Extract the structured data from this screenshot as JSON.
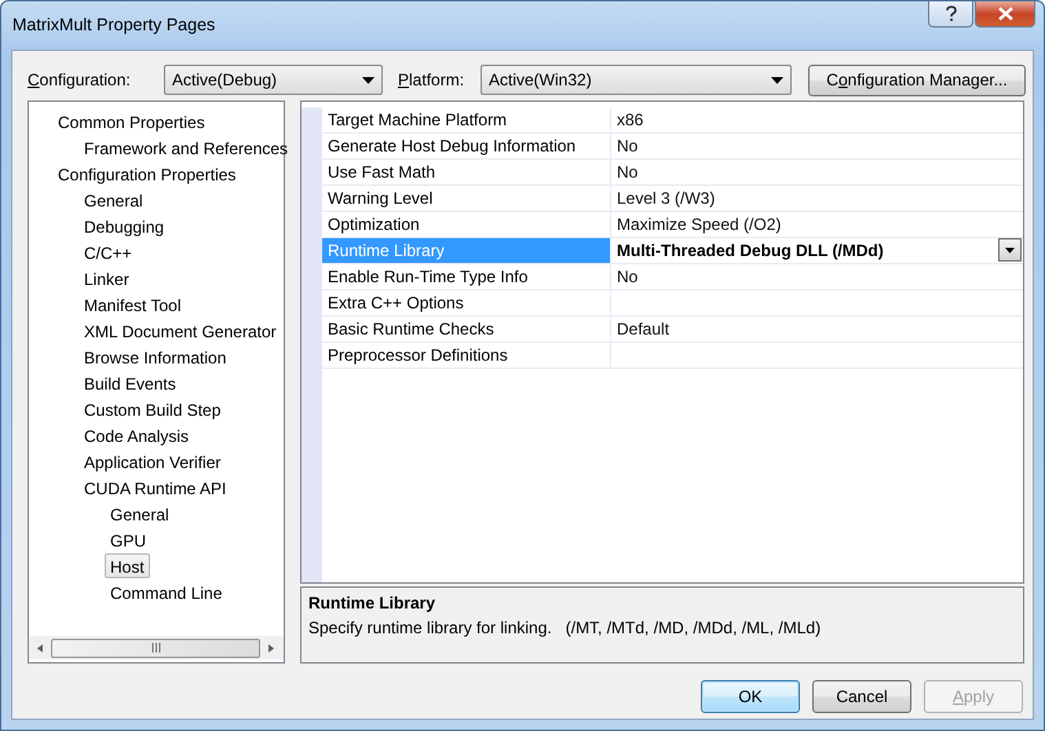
{
  "window": {
    "title": "MatrixMult Property Pages"
  },
  "toolbar": {
    "configuration": {
      "label": [
        {
          "text": "C",
          "underline": true
        },
        {
          "text": "onfiguration:",
          "underline": false
        }
      ],
      "value": "Active(Debug)"
    },
    "platform": {
      "label": [
        {
          "text": "P",
          "underline": true
        },
        {
          "text": "latform:",
          "underline": false
        }
      ],
      "value": "Active(Win32)"
    },
    "manager_button": {
      "label": [
        {
          "text": "C",
          "underline": false
        },
        {
          "text": "o",
          "underline": true
        },
        {
          "text": "nfiguration Manager...",
          "underline": false
        }
      ]
    }
  },
  "tree": [
    {
      "label": "Common Properties",
      "selected": false,
      "children": [
        {
          "label": "Framework and References",
          "selected": false
        }
      ]
    },
    {
      "label": "Configuration Properties",
      "selected": false,
      "children": [
        {
          "label": "General",
          "selected": false
        },
        {
          "label": "Debugging",
          "selected": false
        },
        {
          "label": "C/C++",
          "selected": false
        },
        {
          "label": "Linker",
          "selected": false
        },
        {
          "label": "Manifest Tool",
          "selected": false
        },
        {
          "label": "XML Document Generator",
          "selected": false
        },
        {
          "label": "Browse Information",
          "selected": false
        },
        {
          "label": "Build Events",
          "selected": false
        },
        {
          "label": "Custom Build Step",
          "selected": false
        },
        {
          "label": "Code Analysis",
          "selected": false
        },
        {
          "label": "Application Verifier",
          "selected": false
        },
        {
          "label": "CUDA Runtime API",
          "selected": false,
          "children": [
            {
              "label": "General",
              "selected": false
            },
            {
              "label": "GPU",
              "selected": false
            },
            {
              "label": "Host",
              "selected": true
            },
            {
              "label": "Command Line",
              "selected": false
            }
          ]
        }
      ]
    }
  ],
  "properties": [
    {
      "name": "Target Machine Platform",
      "value": "x86",
      "selected": false,
      "modified": false
    },
    {
      "name": "Generate Host Debug Information",
      "value": "No",
      "selected": false,
      "modified": false
    },
    {
      "name": "Use Fast Math",
      "value": "No",
      "selected": false,
      "modified": false
    },
    {
      "name": "Warning Level",
      "value": "Level 3 (/W3)",
      "selected": false,
      "modified": false
    },
    {
      "name": "Optimization",
      "value": "Maximize Speed (/O2)",
      "selected": false,
      "modified": false
    },
    {
      "name": "Runtime Library",
      "value": "Multi-Threaded Debug DLL (/MDd)",
      "selected": true,
      "modified": true
    },
    {
      "name": "Enable Run-Time Type Info",
      "value": "No",
      "selected": false,
      "modified": false
    },
    {
      "name": "Extra C++ Options",
      "selected": false
    },
    {
      "name": "Basic Runtime Checks",
      "value": "Default",
      "selected": false,
      "modified": false
    },
    {
      "name": "Preprocessor Definitions",
      "selected": false
    }
  ],
  "description": {
    "title": "Runtime Library",
    "text": "Specify runtime library for linking.   (/MT, /MTd, /MD, /MDd, /ML, /MLd)"
  },
  "buttons": [
    {
      "label": [
        {
          "text": "OK",
          "underline": false
        }
      ],
      "default": true,
      "disabled": false
    },
    {
      "label": [
        {
          "text": "Cancel",
          "underline": false
        }
      ],
      "default": false,
      "disabled": false
    },
    {
      "label": [
        {
          "text": "A",
          "underline": true
        },
        {
          "text": "pply",
          "underline": false
        }
      ],
      "default": false,
      "disabled": true
    }
  ]
}
